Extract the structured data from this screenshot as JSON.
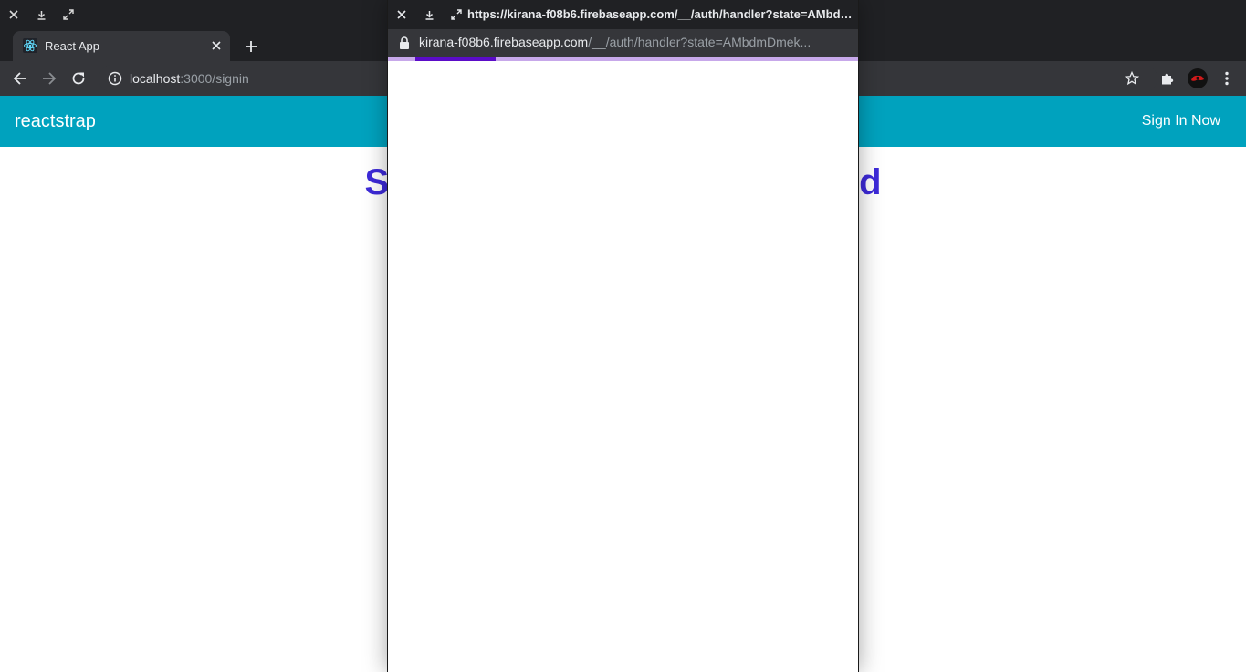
{
  "browser": {
    "window_controls": [
      "close-icon",
      "download-icon",
      "maximize-icon"
    ],
    "tab": {
      "title": "React App",
      "favicon": "react-icon"
    },
    "address": {
      "host": "localhost",
      "path": ":3000/signin"
    },
    "toolbar_icons": [
      "back-icon",
      "forward-icon",
      "reload-icon",
      "info-icon",
      "star-icon",
      "puzzle-icon",
      "profile-avatar",
      "menu-icon"
    ]
  },
  "page": {
    "navbar": {
      "brand": "reactstrap",
      "signin": "Sign In Now"
    },
    "heading": {
      "first_letter": "S",
      "last_letter": "d"
    }
  },
  "popup": {
    "title": "https://kirana-f08b6.firebaseapp.com/__/auth/handler?state=AMbdmDmek...",
    "url_host": "kirana-f08b6.firebaseapp.com",
    "url_path": "/__/auth/handler?state=AMbdmDmek...",
    "loading_progress": 0.17
  },
  "colors": {
    "navbar": "#00a2be",
    "heading": "#3d2ad9",
    "progress": "#5b0cc8",
    "progress_track": "#c7a8ea",
    "chrome_dark": "#202124",
    "chrome_toolbar": "#35363a"
  }
}
